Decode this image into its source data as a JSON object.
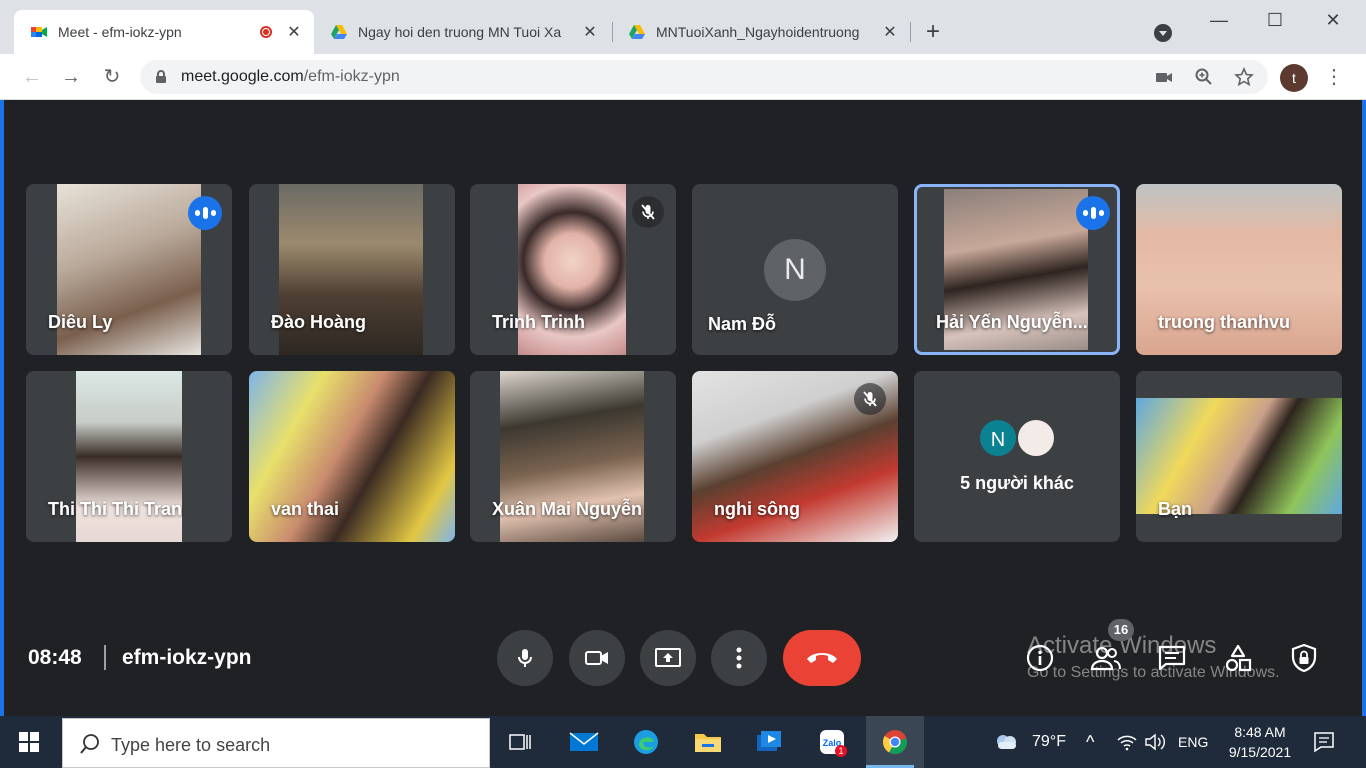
{
  "browser": {
    "tabs": [
      {
        "title": "Meet - efm-iokz-ypn",
        "icon": "google-meet-icon",
        "active": true
      },
      {
        "title": "Ngay hoi den truong MN Tuoi Xa",
        "icon": "google-drive-icon",
        "active": false
      },
      {
        "title": "MNTuoiXanh_Ngayhoidentruong",
        "icon": "google-drive-icon",
        "active": false
      }
    ],
    "close_glyph": "✕",
    "new_tab_glyph": "+",
    "window_controls": {
      "minimize": "—",
      "maximize": "☐",
      "close": "✕"
    },
    "url_host": "meet.google.com",
    "url_path": "/efm-iokz-ypn",
    "profile_initial": "t"
  },
  "meet": {
    "participants_row1": [
      {
        "name": "Diêu Ly",
        "status": "speaking"
      },
      {
        "name": "Đào Hoàng",
        "status": "none"
      },
      {
        "name": "Trinh Trinh",
        "status": "muted"
      },
      {
        "name": "Nam Đỗ",
        "status": "avatar",
        "initial": "N"
      },
      {
        "name": "Hải Yến Nguyễn...",
        "status": "speaking"
      },
      {
        "name": "truong thanhvu",
        "status": "none"
      }
    ],
    "participants_row2": [
      {
        "name": "Thi Thi Thi Tran",
        "status": "none"
      },
      {
        "name": "van thai",
        "status": "none"
      },
      {
        "name": "Xuân Mai Nguyễn",
        "status": "none"
      },
      {
        "name": "nghi sông",
        "status": "muted"
      },
      {
        "name": "5 người khác",
        "status": "others",
        "initial": "N"
      },
      {
        "name": "Bạn",
        "status": "self"
      }
    ],
    "time": "08:48",
    "meeting_code": "efm-iokz-ypn",
    "people_count": "16",
    "colors": {
      "speaking_ring": "#8ab4f8",
      "hangup": "#ea4335",
      "accent": "#1a73e8"
    }
  },
  "activation": {
    "line1": "Activate Windows",
    "line2": "Go to Settings to activate Windows."
  },
  "taskbar": {
    "search_placeholder": "Type here to search",
    "weather": "79°F",
    "language": "ENG",
    "time": "8:48 AM",
    "date": "9/15/2021",
    "zalo_badge": "1",
    "zalo_label": "Zalo"
  }
}
